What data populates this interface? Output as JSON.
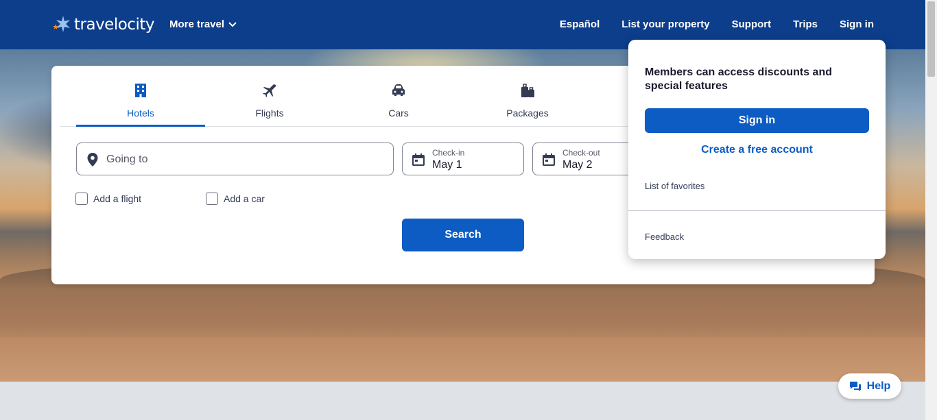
{
  "header": {
    "logo_text": "travelocity",
    "more_travel": "More travel",
    "nav": [
      "Español",
      "List your property",
      "Support",
      "Trips",
      "Sign in"
    ]
  },
  "tabs": [
    {
      "label": "Hotels",
      "icon": "building-icon",
      "active": true
    },
    {
      "label": "Flights",
      "icon": "airplane-icon",
      "active": false
    },
    {
      "label": "Cars",
      "icon": "car-icon",
      "active": false
    },
    {
      "label": "Packages",
      "icon": "luggage-icon",
      "active": false
    }
  ],
  "search": {
    "going_to_placeholder": "Going to",
    "checkin_label": "Check-in",
    "checkin_value": "May 1",
    "checkout_label": "Check-out",
    "checkout_value": "May 2",
    "add_flight": "Add a flight",
    "add_car": "Add a car",
    "search_button": "Search"
  },
  "dropdown": {
    "title": "Members can access discounts and special features",
    "sign_in": "Sign in",
    "create_account": "Create a free account",
    "favorites": "List of favorites",
    "feedback": "Feedback"
  },
  "help": {
    "label": "Help"
  },
  "colors": {
    "header": "#0c3e8c",
    "primary": "#0c5cc4"
  }
}
